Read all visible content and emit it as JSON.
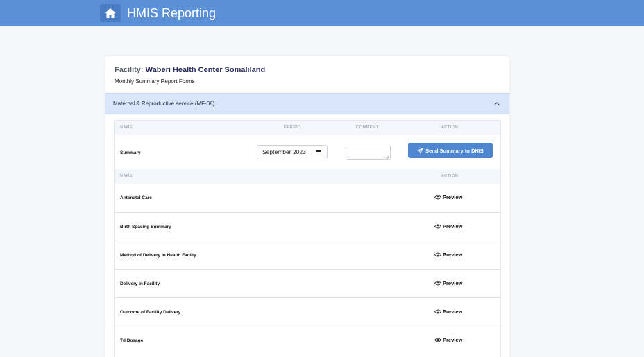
{
  "header": {
    "app_title": "HMIS Reporting",
    "home_icon": "home-icon",
    "bar_color": "#5b8fd6"
  },
  "card": {
    "facility_label": "Facility:",
    "facility_name": "Waberi Health Center Somaliland",
    "subtitle": "Monthly Summary Report Forms"
  },
  "section": {
    "title": "Maternal & Reproductive service (MF-08)",
    "toggle_icon": "chevron-up-icon"
  },
  "summary_table": {
    "headers": {
      "name": "NAME",
      "period": "PERIOD",
      "comment": "COMMENT",
      "action": "ACTION"
    },
    "row": {
      "name": "Summary",
      "period_value": "September 2023",
      "comment_value": "",
      "send_label": "Send Summary to DHIS",
      "send_icon": "send-icon",
      "accent": "#4f86d0"
    }
  },
  "forms_table": {
    "headers": {
      "name": "NAME",
      "action": "ACTION"
    },
    "preview_label": "Preview",
    "preview_icon": "eye-icon",
    "rows": [
      {
        "name": "Antenatal Care"
      },
      {
        "name": "Birth Spacing Summary"
      },
      {
        "name": "Method of Delivery in Health Facilty"
      },
      {
        "name": "Delivery in Facility"
      },
      {
        "name": "Outcome of Facility Delivery"
      },
      {
        "name": "Td Dosage"
      }
    ]
  }
}
